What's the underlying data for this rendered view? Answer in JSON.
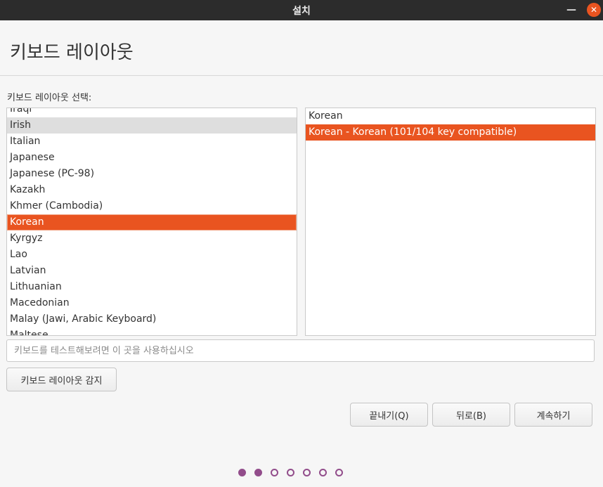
{
  "window": {
    "title": "설치",
    "minimize_icon": "minimize-icon",
    "close_icon": "close-icon"
  },
  "header": {
    "title": "키보드 레이아웃"
  },
  "layout_section": {
    "label": "키보드 레이아웃 선택:"
  },
  "layouts": [
    {
      "label": "Iraqi",
      "state": "normal"
    },
    {
      "label": "Irish",
      "state": "hover"
    },
    {
      "label": "Italian",
      "state": "normal"
    },
    {
      "label": "Japanese",
      "state": "normal"
    },
    {
      "label": "Japanese (PC-98)",
      "state": "normal"
    },
    {
      "label": "Kazakh",
      "state": "normal"
    },
    {
      "label": "Khmer (Cambodia)",
      "state": "normal"
    },
    {
      "label": "Korean",
      "state": "selected"
    },
    {
      "label": "Kyrgyz",
      "state": "normal"
    },
    {
      "label": "Lao",
      "state": "normal"
    },
    {
      "label": "Latvian",
      "state": "normal"
    },
    {
      "label": "Lithuanian",
      "state": "normal"
    },
    {
      "label": "Macedonian",
      "state": "normal"
    },
    {
      "label": "Malay (Jawi, Arabic Keyboard)",
      "state": "normal"
    },
    {
      "label": "Maltese",
      "state": "normal"
    }
  ],
  "variants": [
    {
      "label": "Korean",
      "state": "normal"
    },
    {
      "label": "Korean - Korean (101/104 key compatible)",
      "state": "selected"
    }
  ],
  "test_field": {
    "placeholder": "키보드를 테스트해보려면 이 곳을 사용하십시오",
    "value": ""
  },
  "buttons": {
    "detect": "키보드 레이아웃 감지",
    "quit": "끝내기(Q)",
    "back": "뒤로(B)",
    "continue": "계속하기"
  },
  "progress": {
    "total_steps": 7,
    "current_step": 2,
    "color": "#924d8b"
  },
  "colors": {
    "accent": "#e95420",
    "titlebar": "#2c2c2c"
  }
}
